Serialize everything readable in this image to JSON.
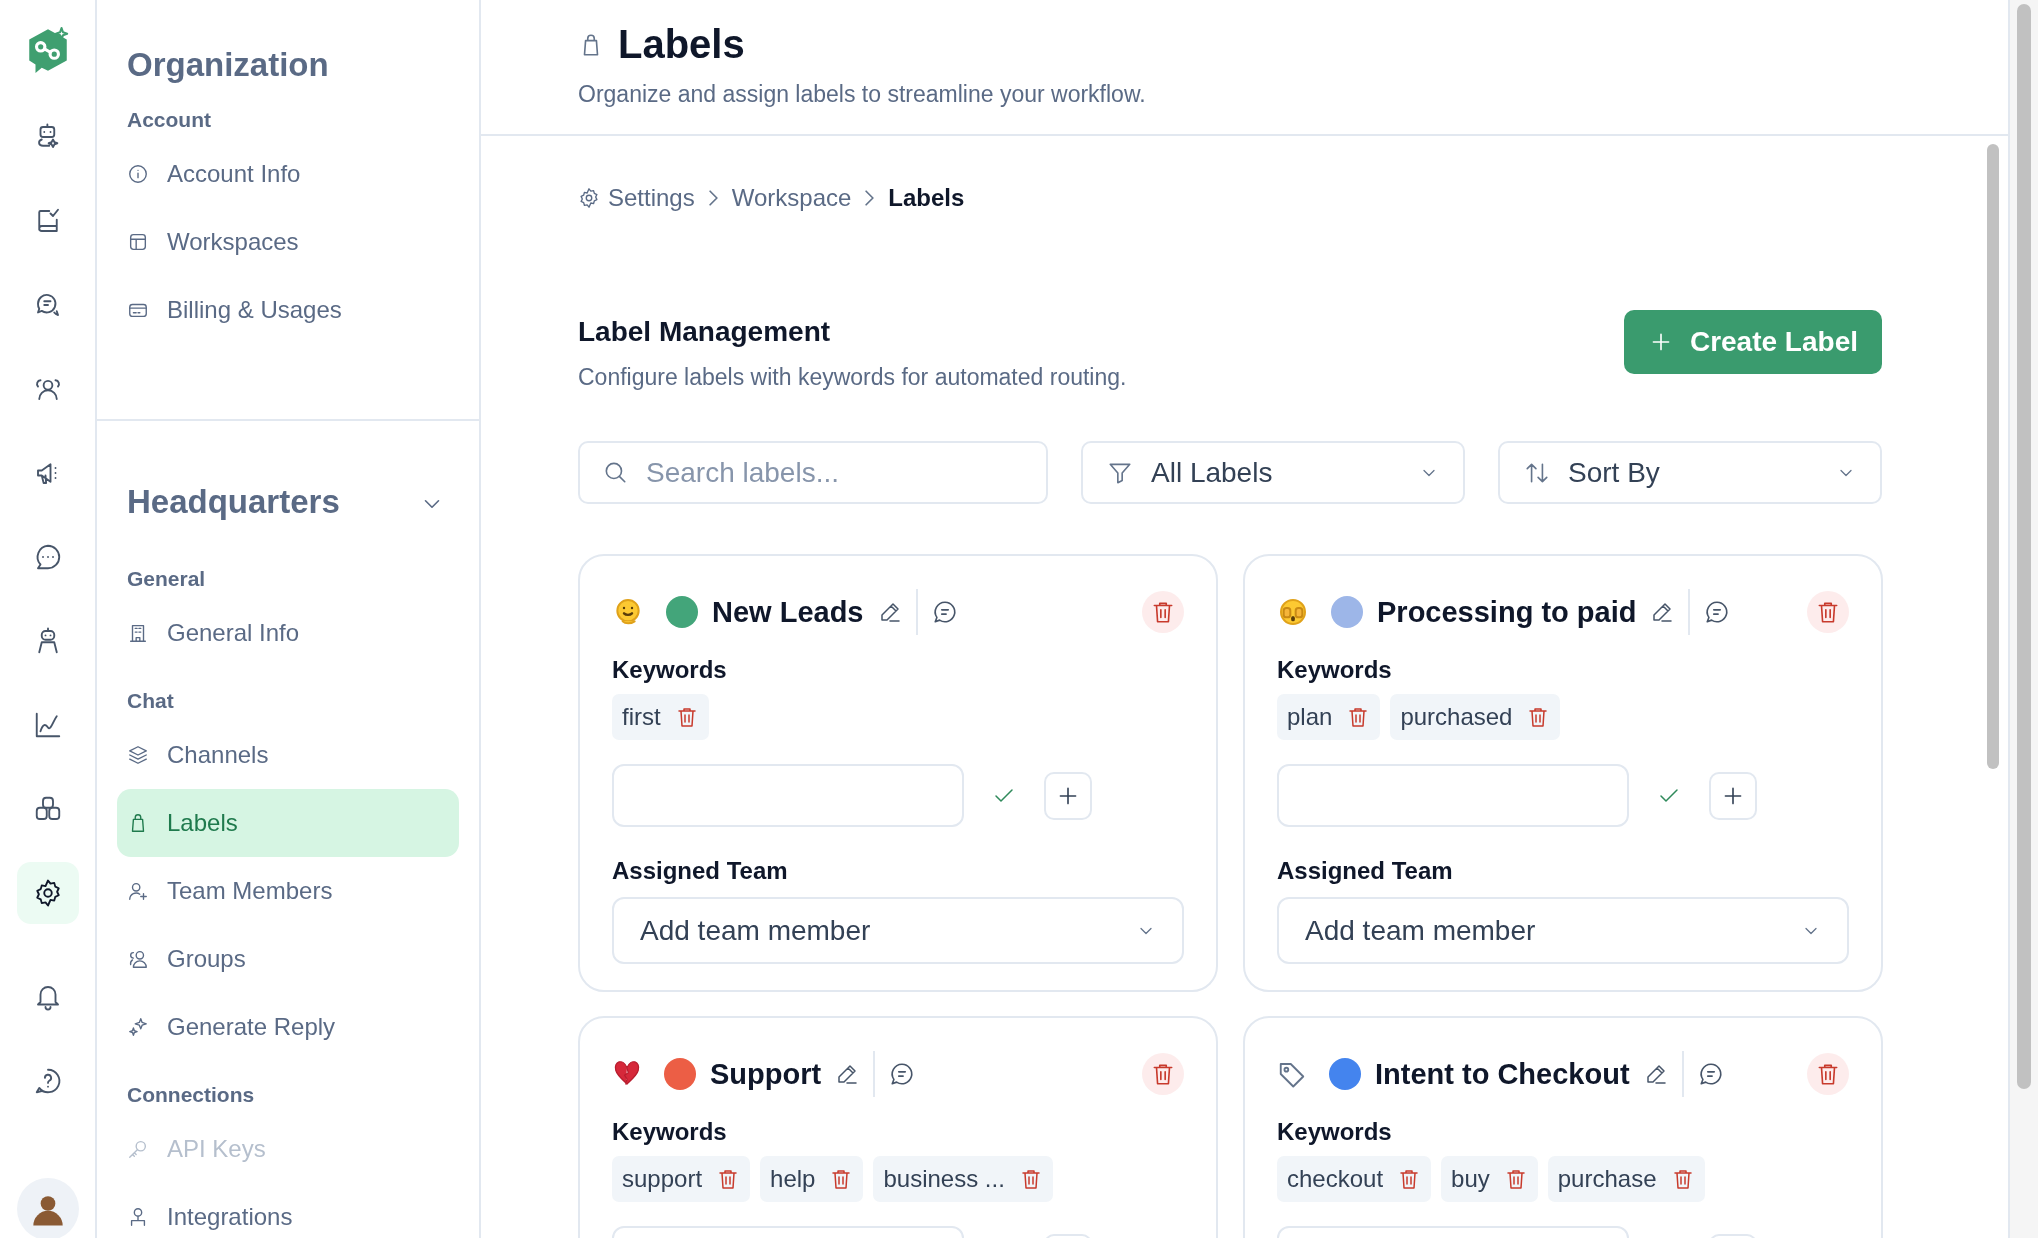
{
  "rail": {
    "items": [
      {
        "selected": false
      },
      {
        "selected": false
      },
      {
        "selected": false
      },
      {
        "selected": false
      },
      {
        "selected": false
      },
      {
        "selected": false
      },
      {
        "selected": false
      },
      {
        "selected": false
      },
      {
        "selected": false
      },
      {
        "selected": true
      },
      {
        "selected": false
      },
      {
        "selected": false
      }
    ]
  },
  "sidebar": {
    "title": "Organization",
    "sections": [
      {
        "heading": "Account",
        "items": [
          {
            "label": "Account Info",
            "selected": false,
            "disabled": false
          },
          {
            "label": "Workspaces",
            "selected": false,
            "disabled": false
          },
          {
            "label": "Billing & Usages",
            "selected": false,
            "disabled": false
          }
        ]
      }
    ],
    "workspace": {
      "title": "Headquarters",
      "expanded": true,
      "sections": [
        {
          "heading": "General",
          "items": [
            {
              "label": "General Info",
              "selected": false,
              "disabled": false
            }
          ]
        },
        {
          "heading": "Chat",
          "items": [
            {
              "label": "Channels",
              "selected": false,
              "disabled": false
            },
            {
              "label": "Labels",
              "selected": true,
              "disabled": false
            },
            {
              "label": "Team Members",
              "selected": false,
              "disabled": false
            },
            {
              "label": "Groups",
              "selected": false,
              "disabled": false
            },
            {
              "label": "Generate Reply",
              "selected": false,
              "disabled": false
            }
          ]
        },
        {
          "heading": "Connections",
          "items": [
            {
              "label": "API Keys",
              "selected": false,
              "disabled": true
            },
            {
              "label": "Integrations",
              "selected": false,
              "disabled": false
            }
          ]
        }
      ]
    }
  },
  "header": {
    "title": "Labels",
    "subtitle": "Organize and assign labels to streamline your workflow."
  },
  "breadcrumb": [
    "Settings",
    "Workspace",
    "Labels"
  ],
  "management": {
    "title": "Label Management",
    "subtitle": "Configure labels with keywords for automated routing.",
    "create_button": "Create Label"
  },
  "filters": {
    "search_placeholder": "Search labels...",
    "filter": "All Labels",
    "sort": "Sort By"
  },
  "labels": [
    {
      "name": "New Leads",
      "color": "#43a57a",
      "keywords_heading": "Keywords",
      "keywords": [
        "first"
      ],
      "team_heading": "Assigned Team",
      "team_placeholder": "Add team member"
    },
    {
      "name": "Processing to paid",
      "color": "#9db6e8",
      "keywords_heading": "Keywords",
      "keywords": [
        "plan",
        "purchased"
      ],
      "team_heading": "Assigned Team",
      "team_placeholder": "Add team member"
    },
    {
      "name": "Support",
      "color": "#ec5e45",
      "keywords_heading": "Keywords",
      "keywords": [
        "support",
        "help",
        "business ..."
      ]
    },
    {
      "name": "Intent to Checkout",
      "color": "#4484ee",
      "keywords_heading": "Keywords",
      "keywords": [
        "checkout",
        "buy",
        "purchase"
      ]
    }
  ]
}
